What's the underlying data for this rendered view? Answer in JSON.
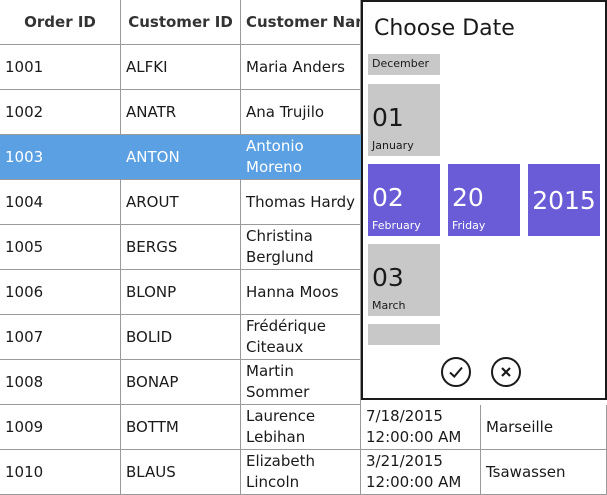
{
  "grid": {
    "headers": [
      "Order ID",
      "Customer ID",
      "Customer Nam"
    ],
    "rows": [
      {
        "order_id": "1001",
        "customer_id": "ALFKI",
        "customer_name": "Maria Anders",
        "date": "",
        "city": ""
      },
      {
        "order_id": "1002",
        "customer_id": "ANATR",
        "customer_name": "Ana Trujilo",
        "date": "",
        "city": ""
      },
      {
        "order_id": "1003",
        "customer_id": "ANTON",
        "customer_name": "Antonio Moreno",
        "date": "",
        "city": ""
      },
      {
        "order_id": "1004",
        "customer_id": "AROUT",
        "customer_name": "Thomas Hardy",
        "date": "",
        "city": ""
      },
      {
        "order_id": "1005",
        "customer_id": "BERGS",
        "customer_name": "Christina Berglund",
        "date": "",
        "city": ""
      },
      {
        "order_id": "1006",
        "customer_id": "BLONP",
        "customer_name": "Hanna Moos",
        "date": "",
        "city": ""
      },
      {
        "order_id": "1007",
        "customer_id": "BOLID",
        "customer_name": "Frédérique Citeaux",
        "date": "",
        "city": ""
      },
      {
        "order_id": "1008",
        "customer_id": "BONAP",
        "customer_name": "Martin Sommer",
        "date": "",
        "city": ""
      },
      {
        "order_id": "1009",
        "customer_id": "BOTTM",
        "customer_name": "Laurence Lebihan",
        "date": "7/18/2015 12:00:00 AM",
        "city": "Marseille"
      },
      {
        "order_id": "1010",
        "customer_id": "BLAUS",
        "customer_name": "Elizabeth Lincoln",
        "date": "3/21/2015 12:00:00 AM",
        "city": "Tsawassen"
      }
    ],
    "selected_row_index": 2
  },
  "date_picker": {
    "title": "Choose Date",
    "month_prev": {
      "label": "December"
    },
    "months": [
      {
        "num": "01",
        "name": "January",
        "selected": false
      },
      {
        "num": "02",
        "name": "February",
        "selected": true
      },
      {
        "num": "03",
        "name": "March",
        "selected": false
      }
    ],
    "day": {
      "num": "20",
      "name": "Friday",
      "selected": true
    },
    "year": {
      "value": "2015",
      "selected": true
    },
    "accept_icon": "checkmark-icon",
    "cancel_icon": "close-icon",
    "colors": {
      "selected_tile": "#6a5bd6",
      "unselected_tile": "#c8c8c8",
      "selected_row": "#5aa0e2"
    }
  }
}
